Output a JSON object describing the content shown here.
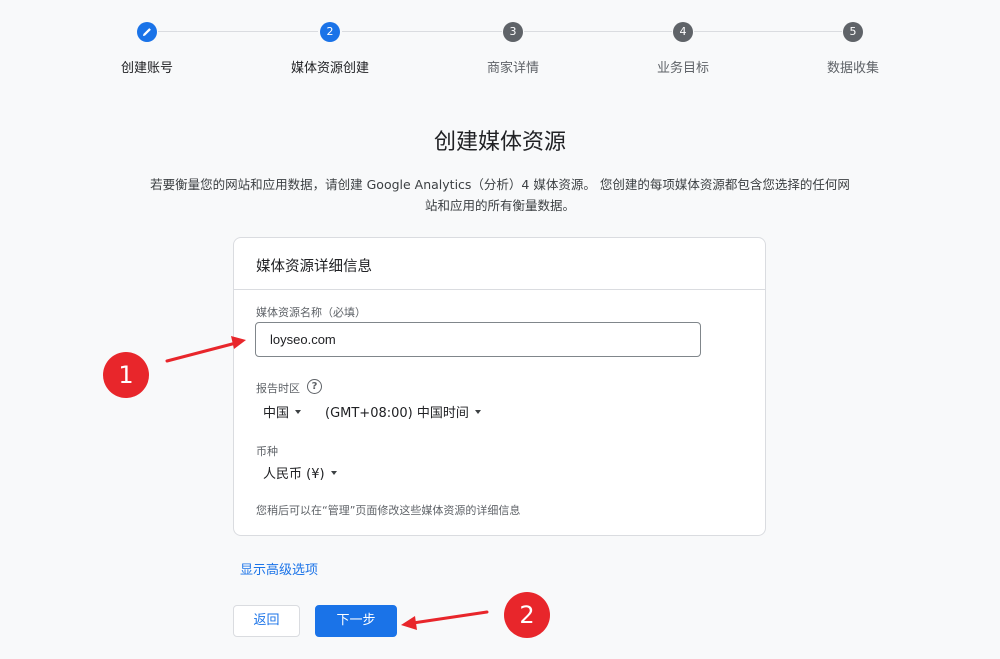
{
  "stepper": {
    "steps": [
      {
        "label": "创建账号",
        "number": "",
        "status": "done"
      },
      {
        "label": "媒体资源创建",
        "number": "2",
        "status": "active"
      },
      {
        "label": "商家详情",
        "number": "3",
        "status": "pending"
      },
      {
        "label": "业务目标",
        "number": "4",
        "status": "pending"
      },
      {
        "label": "数据收集",
        "number": "5",
        "status": "pending"
      }
    ]
  },
  "page": {
    "title": "创建媒体资源",
    "description_line1": "若要衡量您的网站和应用数据，请创建 Google Analytics（分析）4 媒体资源。 您创建的每项媒体资源都包含您选择的任何网",
    "description_line2": "站和应用的所有衡量数据。"
  },
  "card": {
    "header": "媒体资源详细信息",
    "property_name": {
      "label": "媒体资源名称（必填）",
      "value": "loyseo.com"
    },
    "timezone": {
      "label": "报告时区",
      "help_icon": "?",
      "country": "中国",
      "zone": "(GMT+08:00) 中国时间"
    },
    "currency": {
      "label": "币种",
      "value": "人民币 (¥)"
    },
    "note": "您稍后可以在“管理”页面修改这些媒体资源的详细信息"
  },
  "advanced_link": "显示高级选项",
  "buttons": {
    "back": "返回",
    "next": "下一步"
  },
  "annotations": {
    "badge1": "1",
    "badge2": "2",
    "color": "#e8262b"
  },
  "colors": {
    "accent": "#1a73e8",
    "pending_step": "#5f6368"
  }
}
